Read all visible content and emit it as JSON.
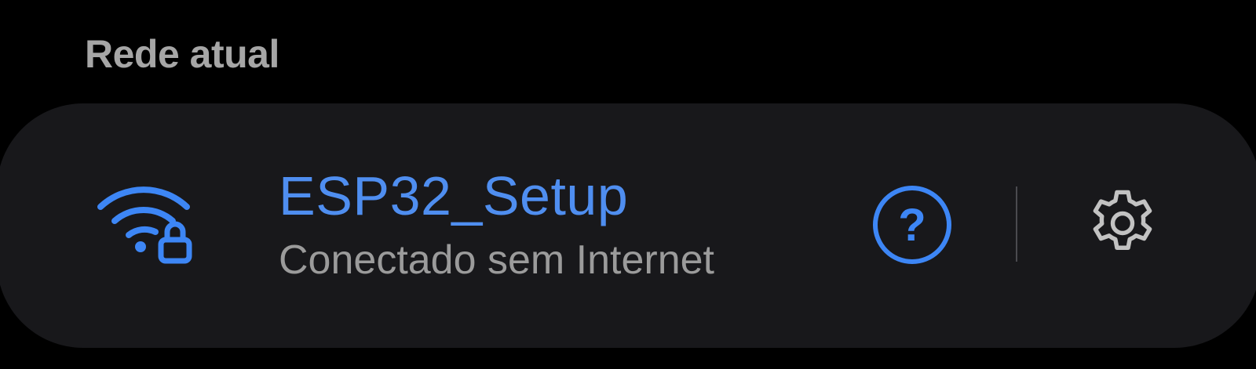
{
  "section": {
    "title": "Rede atual"
  },
  "current_network": {
    "name": "ESP32_Setup",
    "status": "Conectado sem Internet",
    "signal_icon": "wifi-lock-icon",
    "help_button": {
      "label": "?",
      "icon": "help-icon"
    },
    "settings_button": {
      "icon": "gear-icon"
    }
  },
  "colors": {
    "background": "#000000",
    "card": "#18181b",
    "accent": "#3d86f5",
    "network_name": "#4f8ef0",
    "secondary_text": "#9b9b9b",
    "header_text": "#a6a6a6",
    "settings_icon": "#c2c2c2"
  }
}
